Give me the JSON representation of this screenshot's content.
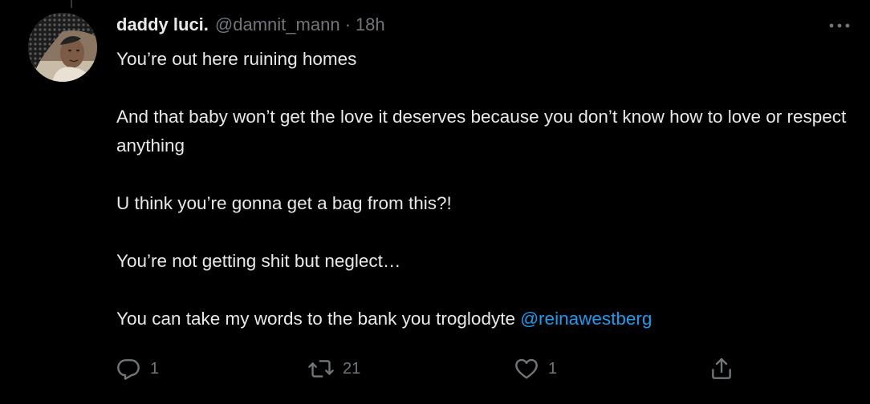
{
  "tweet": {
    "display_name": "daddy luci.",
    "handle": "@damnit_mann",
    "separator": "·",
    "time": "18h",
    "paragraphs": [
      "You’re out here ruining homes",
      "And that baby won’t get the love it deserves because you don’t know how to love or respect anything",
      "U think you’re gonna get a bag from this?!",
      "You’re not getting shit but neglect…"
    ],
    "last_paragraph_text": "You can take my words to the bank you troglodyte ",
    "mention": "@reinawestberg"
  },
  "actions": {
    "reply_count": "1",
    "retweet_count": "21",
    "like_count": "1"
  },
  "icons": {
    "more": "more-horizontal-icon",
    "reply": "reply-icon",
    "retweet": "retweet-icon",
    "like": "heart-icon",
    "share": "share-icon"
  },
  "colors": {
    "background": "#000000",
    "text": "#e7e9ea",
    "secondary": "#71767b",
    "accent": "#1d9bf0"
  }
}
